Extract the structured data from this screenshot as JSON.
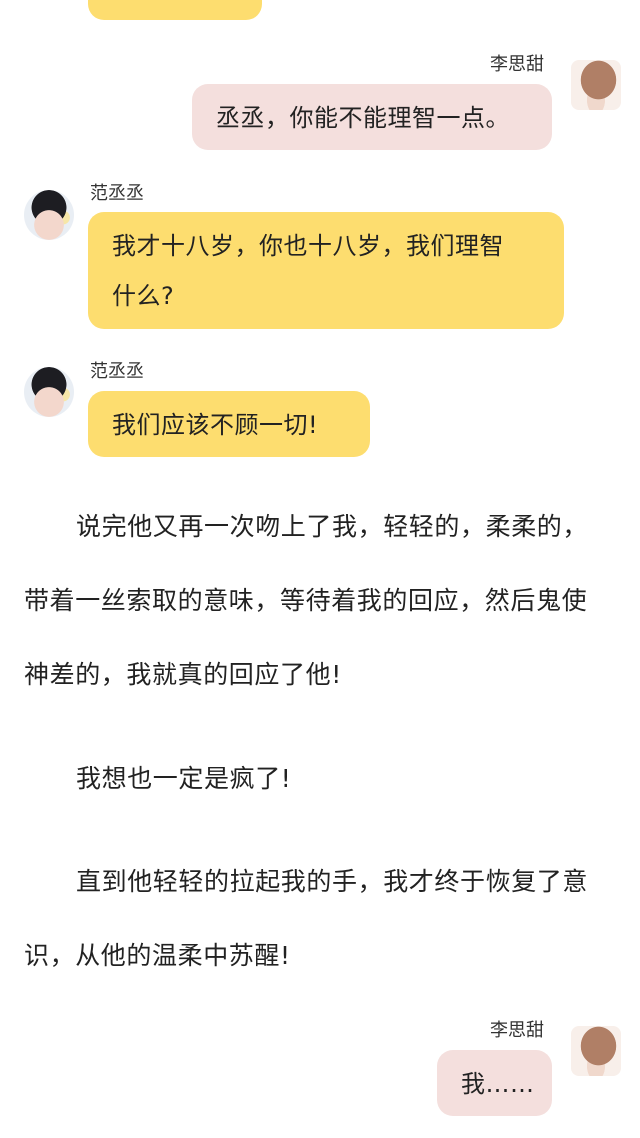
{
  "chat": [
    {
      "sender": "李思甜",
      "side": "right",
      "text": "丞丞，你能不能理智一点。"
    },
    {
      "sender": "范丞丞",
      "side": "left",
      "text_lines": [
        "我才十八岁，你也十八岁，我们理智",
        "什么?"
      ]
    },
    {
      "sender": "范丞丞",
      "side": "left",
      "text": "我们应该不顾一切!"
    }
  ],
  "narrative": {
    "p1_lines": [
      "说完他又再一次吻上了我，轻轻的，柔柔的，",
      "带着一丝索取的意味，等待着我的回应，然后鬼使",
      "神差的，我就真的回应了他!"
    ],
    "p2": "我想也一定是疯了!",
    "p3_lines": [
      "直到他轻轻的拉起我的手，我才终于恢复了意",
      "识，从他的温柔中苏醒!"
    ]
  },
  "last_message": {
    "sender": "李思甜",
    "side": "right",
    "text": "我……"
  },
  "colors": {
    "left_bubble": "#fddd6f",
    "right_bubble": "#f4dfdd"
  },
  "icons": {
    "boy_avatar": "avatar-icon",
    "girl_avatar": "avatar-icon"
  }
}
